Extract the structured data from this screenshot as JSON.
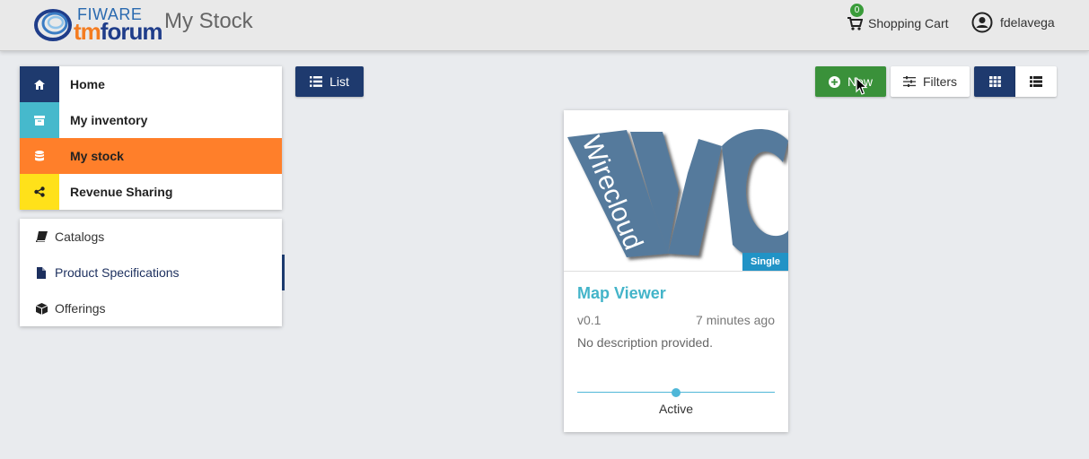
{
  "header": {
    "logo_top": "FIWARE",
    "logo_bottom_tm": "tm",
    "logo_bottom_forum": "forum",
    "page_title": "My Stock",
    "cart_count": "0",
    "cart_label": "Shopping Cart",
    "username": "fdelavega"
  },
  "main_menu": {
    "items": [
      {
        "label": "Home",
        "icon": "home-icon",
        "color": "#1e3a6e"
      },
      {
        "label": "My inventory",
        "icon": "archive-icon",
        "color": "#46b9cc"
      },
      {
        "label": "My stock",
        "icon": "database-icon",
        "color": "#ff7f2a"
      },
      {
        "label": "Revenue Sharing",
        "icon": "share-icon",
        "color": "#ffe11a"
      }
    ],
    "active": "My stock"
  },
  "sub_menu": {
    "items": [
      {
        "label": "Catalogs",
        "icon": "book-icon"
      },
      {
        "label": "Product Specifications",
        "icon": "file-icon"
      },
      {
        "label": "Offerings",
        "icon": "cube-icon"
      }
    ],
    "active": "Product Specifications"
  },
  "toolbar": {
    "list_label": "List",
    "new_label": "New",
    "filters_label": "Filters"
  },
  "card": {
    "image_text": "Wirecloud",
    "tag": "Single",
    "title": "Map Viewer",
    "version": "v0.1",
    "time": "7 minutes ago",
    "description": "No description provided.",
    "status": "Active"
  },
  "colors": {
    "accent_orange": "#ff7f2a",
    "navy": "#1e3a6e",
    "green": "#3a913a",
    "teal": "#43b4c9"
  }
}
